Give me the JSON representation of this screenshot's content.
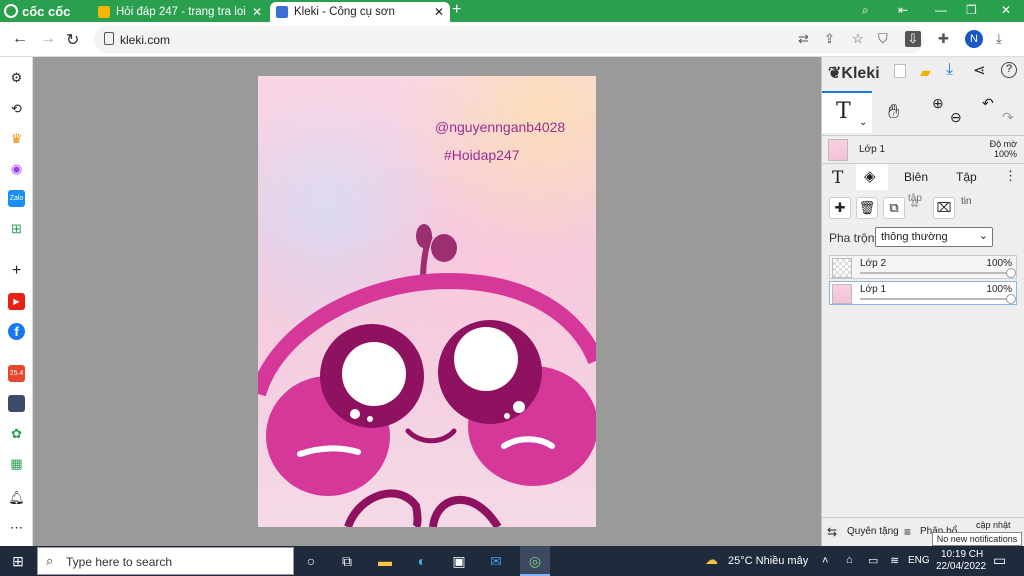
{
  "browser": {
    "brand": "cốc cốc",
    "tabs": [
      {
        "label": "Hỏi đáp 247 - trang tra loi",
        "active": false
      },
      {
        "label": "Kleki - Công cụ sơn",
        "active": true
      }
    ],
    "url": "kleki.com",
    "profile_initial": "N"
  },
  "canvas": {
    "watermark_user": "@nguyennganb4028",
    "watermark_tag": "#Hoidap247"
  },
  "kleki": {
    "logo_text": "Kleki",
    "current_layer_label": "Lớp 1",
    "opacity_label": "Độ mờ",
    "opacity_value": "100%",
    "tabs": {
      "edit": "Biên",
      "file": "Tập"
    },
    "file_hint": "tập",
    "info_hint": "tin",
    "blend_label": "Pha trộn",
    "blend_value": "thông thường",
    "layers": [
      {
        "name": "Lớp 2",
        "opacity": "100%",
        "opacity_value": 1.0,
        "selected": false
      },
      {
        "name": "Lớp 1",
        "opacity": "100%",
        "opacity_value": 1.0,
        "selected": true
      }
    ],
    "footer": {
      "donate": "Quyên tặng",
      "changelog": "Phân bổ",
      "update": "cập nhật"
    }
  },
  "taskbar": {
    "search_placeholder": "Type here to search",
    "weather": "25°C  Nhiều mây",
    "language": "ENG",
    "time": "10:19 CH",
    "date": "22/04/2022",
    "notification": "No new notifications"
  },
  "colors": {
    "browser_green": "#2a9f4e",
    "accent_magenta": "#d6389a",
    "dark_magenta": "#8e1260",
    "watermark_purple": "#9b2f8f"
  }
}
